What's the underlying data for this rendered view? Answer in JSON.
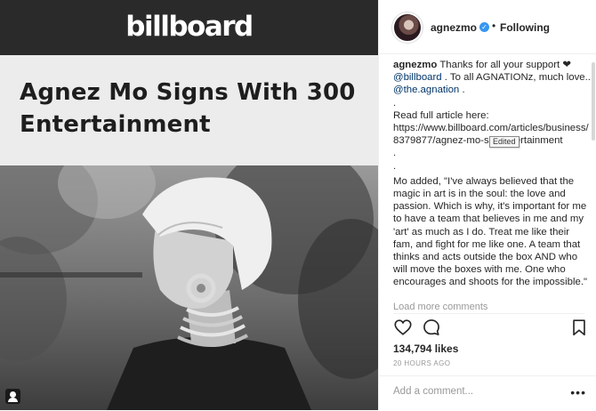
{
  "media": {
    "brand_logo": "billboard",
    "headline": "Agnez Mo Signs With 300 Entertainment"
  },
  "post": {
    "username": "agnezmo",
    "verified_icon": "verified-check-icon",
    "separator": "•",
    "follow_status": "Following",
    "caption": {
      "author": "agnezmo",
      "line1_text": " Thanks for all your support ❤",
      "mention1": "@billboard",
      "line2_text": " . To all AGNATIONz, much love..",
      "mention2": "@the.agnation",
      "line3_text": " .",
      "sep1": ".",
      "read_label": "Read full article here:",
      "url": "https://www.billboard.com/articles/business/8379877/agnez-mo-s   0-entertainment",
      "sep2": ".",
      "sep3": ".",
      "quote": "Mo added, \"I've always believed that the magic in art is in the soul: the love and passion. Which is why, it's important for me to have a team that believes in me and my 'art' as much as I do. Treat me like their fam, and fight for me like one. A team that thinks and acts outside the box AND who will move the boxes with me. One who encourages and shoots for the impossible.\""
    },
    "tooltip": "Edited",
    "load_more": "Load more comments",
    "likes": "134,794 likes",
    "time": "20 HOURS AGO",
    "comment_placeholder": "Add a comment...",
    "more_options": "•••"
  },
  "icons": {
    "like": "heart-icon",
    "comment": "comment-bubble-icon",
    "save": "bookmark-icon",
    "profile": "person-icon"
  },
  "colors": {
    "link": "#003569",
    "verified": "#3897f0",
    "header_bg": "#2a2a2a"
  }
}
